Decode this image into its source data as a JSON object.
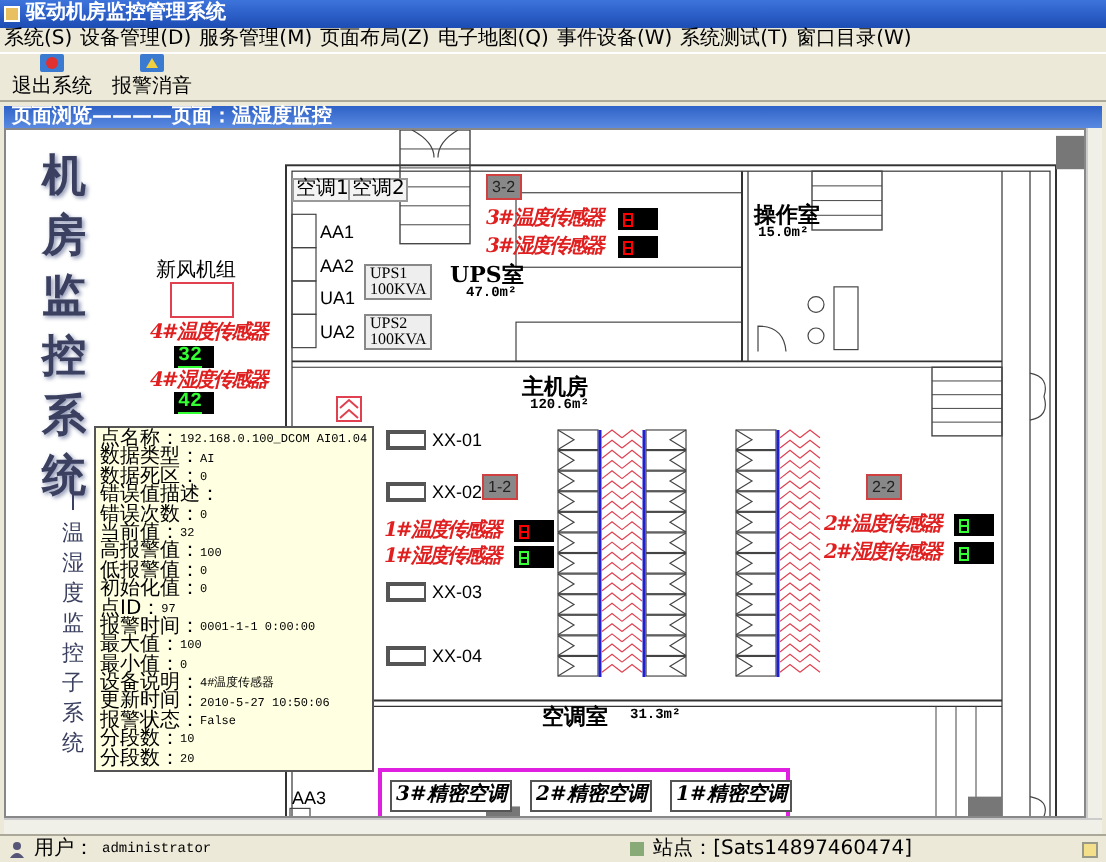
{
  "window": {
    "title": "驱动机房监控管理系统"
  },
  "menu": [
    "系统(S)",
    "设备管理(D)",
    "服务管理(M)",
    "页面布局(Z)",
    "电子地图(Q)",
    "事件设备(W)",
    "系统测试(T)",
    "窗口目录(W)"
  ],
  "toolbar": [
    {
      "kind": "exit",
      "label": "退出系统"
    },
    {
      "kind": "mute",
      "label": "报警消音"
    }
  ],
  "breadcrumb": "页面浏览————页面：温湿度监控",
  "side_title": {
    "main": "机房监控系统",
    "sub": "温湿度监控子系统"
  },
  "plan": {
    "rooms": [
      {
        "name": "UPS室",
        "area": "47.0m²"
      },
      {
        "name": "操作室",
        "area": "15.0m²"
      },
      {
        "name": "主机房",
        "area": "120.6m²"
      },
      {
        "name": "空调室",
        "area": "31.3m²"
      }
    ],
    "ac_buttons": [
      "空调1",
      "空调2"
    ],
    "doors": [
      "3-2",
      "1-2",
      "2-2"
    ],
    "panels": [
      "AA1",
      "AA2",
      "UA1",
      "UA2",
      "AA3"
    ],
    "ups": [
      {
        "name": "UPS1",
        "capacity": "100KVA"
      },
      {
        "name": "UPS2",
        "capacity": "100KVA"
      }
    ],
    "racks": [
      "XX-01",
      "XX-02",
      "XX-03",
      "XX-04"
    ],
    "fresh_air": "新风机组",
    "sensors": [
      {
        "label": "3#温度传感器",
        "color": "#ff0000"
      },
      {
        "label": "3#湿度传感器",
        "color": "#ff0000"
      },
      {
        "label": "1#温度传感器",
        "color": "#ff0000"
      },
      {
        "label": "1#湿度传感器",
        "color": "#33ff33"
      },
      {
        "label": "2#温度传感器",
        "color": "#33ff33"
      },
      {
        "label": "2#湿度传感器",
        "color": "#33ff33"
      },
      {
        "label": "4#温度传感器",
        "value": "32",
        "color": "#33ff33"
      },
      {
        "label": "4#湿度传感器",
        "value": "42",
        "color": "#33ff33"
      }
    ],
    "ac_units": [
      "3#精密空调",
      "2#精密空调",
      "1#精密空调"
    ]
  },
  "tooltip": [
    {
      "key": "点名称：",
      "value": "192.168.0.100_DCOM AI01.04"
    },
    {
      "key": "数据类型：",
      "value": "AI"
    },
    {
      "key": "数据死区：",
      "value": "0"
    },
    {
      "key": "错误值描述："
    },
    {
      "key": "错误次数：",
      "value": "0"
    },
    {
      "key": "当前值：",
      "value": "32"
    },
    {
      "key": "高报警值：",
      "value": "100"
    },
    {
      "key": "低报警值：",
      "value": "0"
    },
    {
      "key": "初始化值：",
      "value": "0"
    },
    {
      "key": "点ID：",
      "value": "97"
    },
    {
      "key": "报警时间：",
      "value": "0001-1-1 0:00:00"
    },
    {
      "key": "最大值：",
      "value": "100"
    },
    {
      "key": "最小值：",
      "value": "0"
    },
    {
      "key": "设备说明：",
      "value": "4#温度传感器"
    },
    {
      "key": "更新时间：",
      "value": "2010-5-27 10:50:06"
    },
    {
      "key": "报警状态：",
      "value": "False"
    },
    {
      "key": "分段数：",
      "value": "10"
    },
    {
      "key": "分段数：",
      "value": "20"
    }
  ],
  "status_bar": {
    "user_label": "用户：",
    "user": "administrator",
    "site": "站点：[Sats14897460474]"
  }
}
